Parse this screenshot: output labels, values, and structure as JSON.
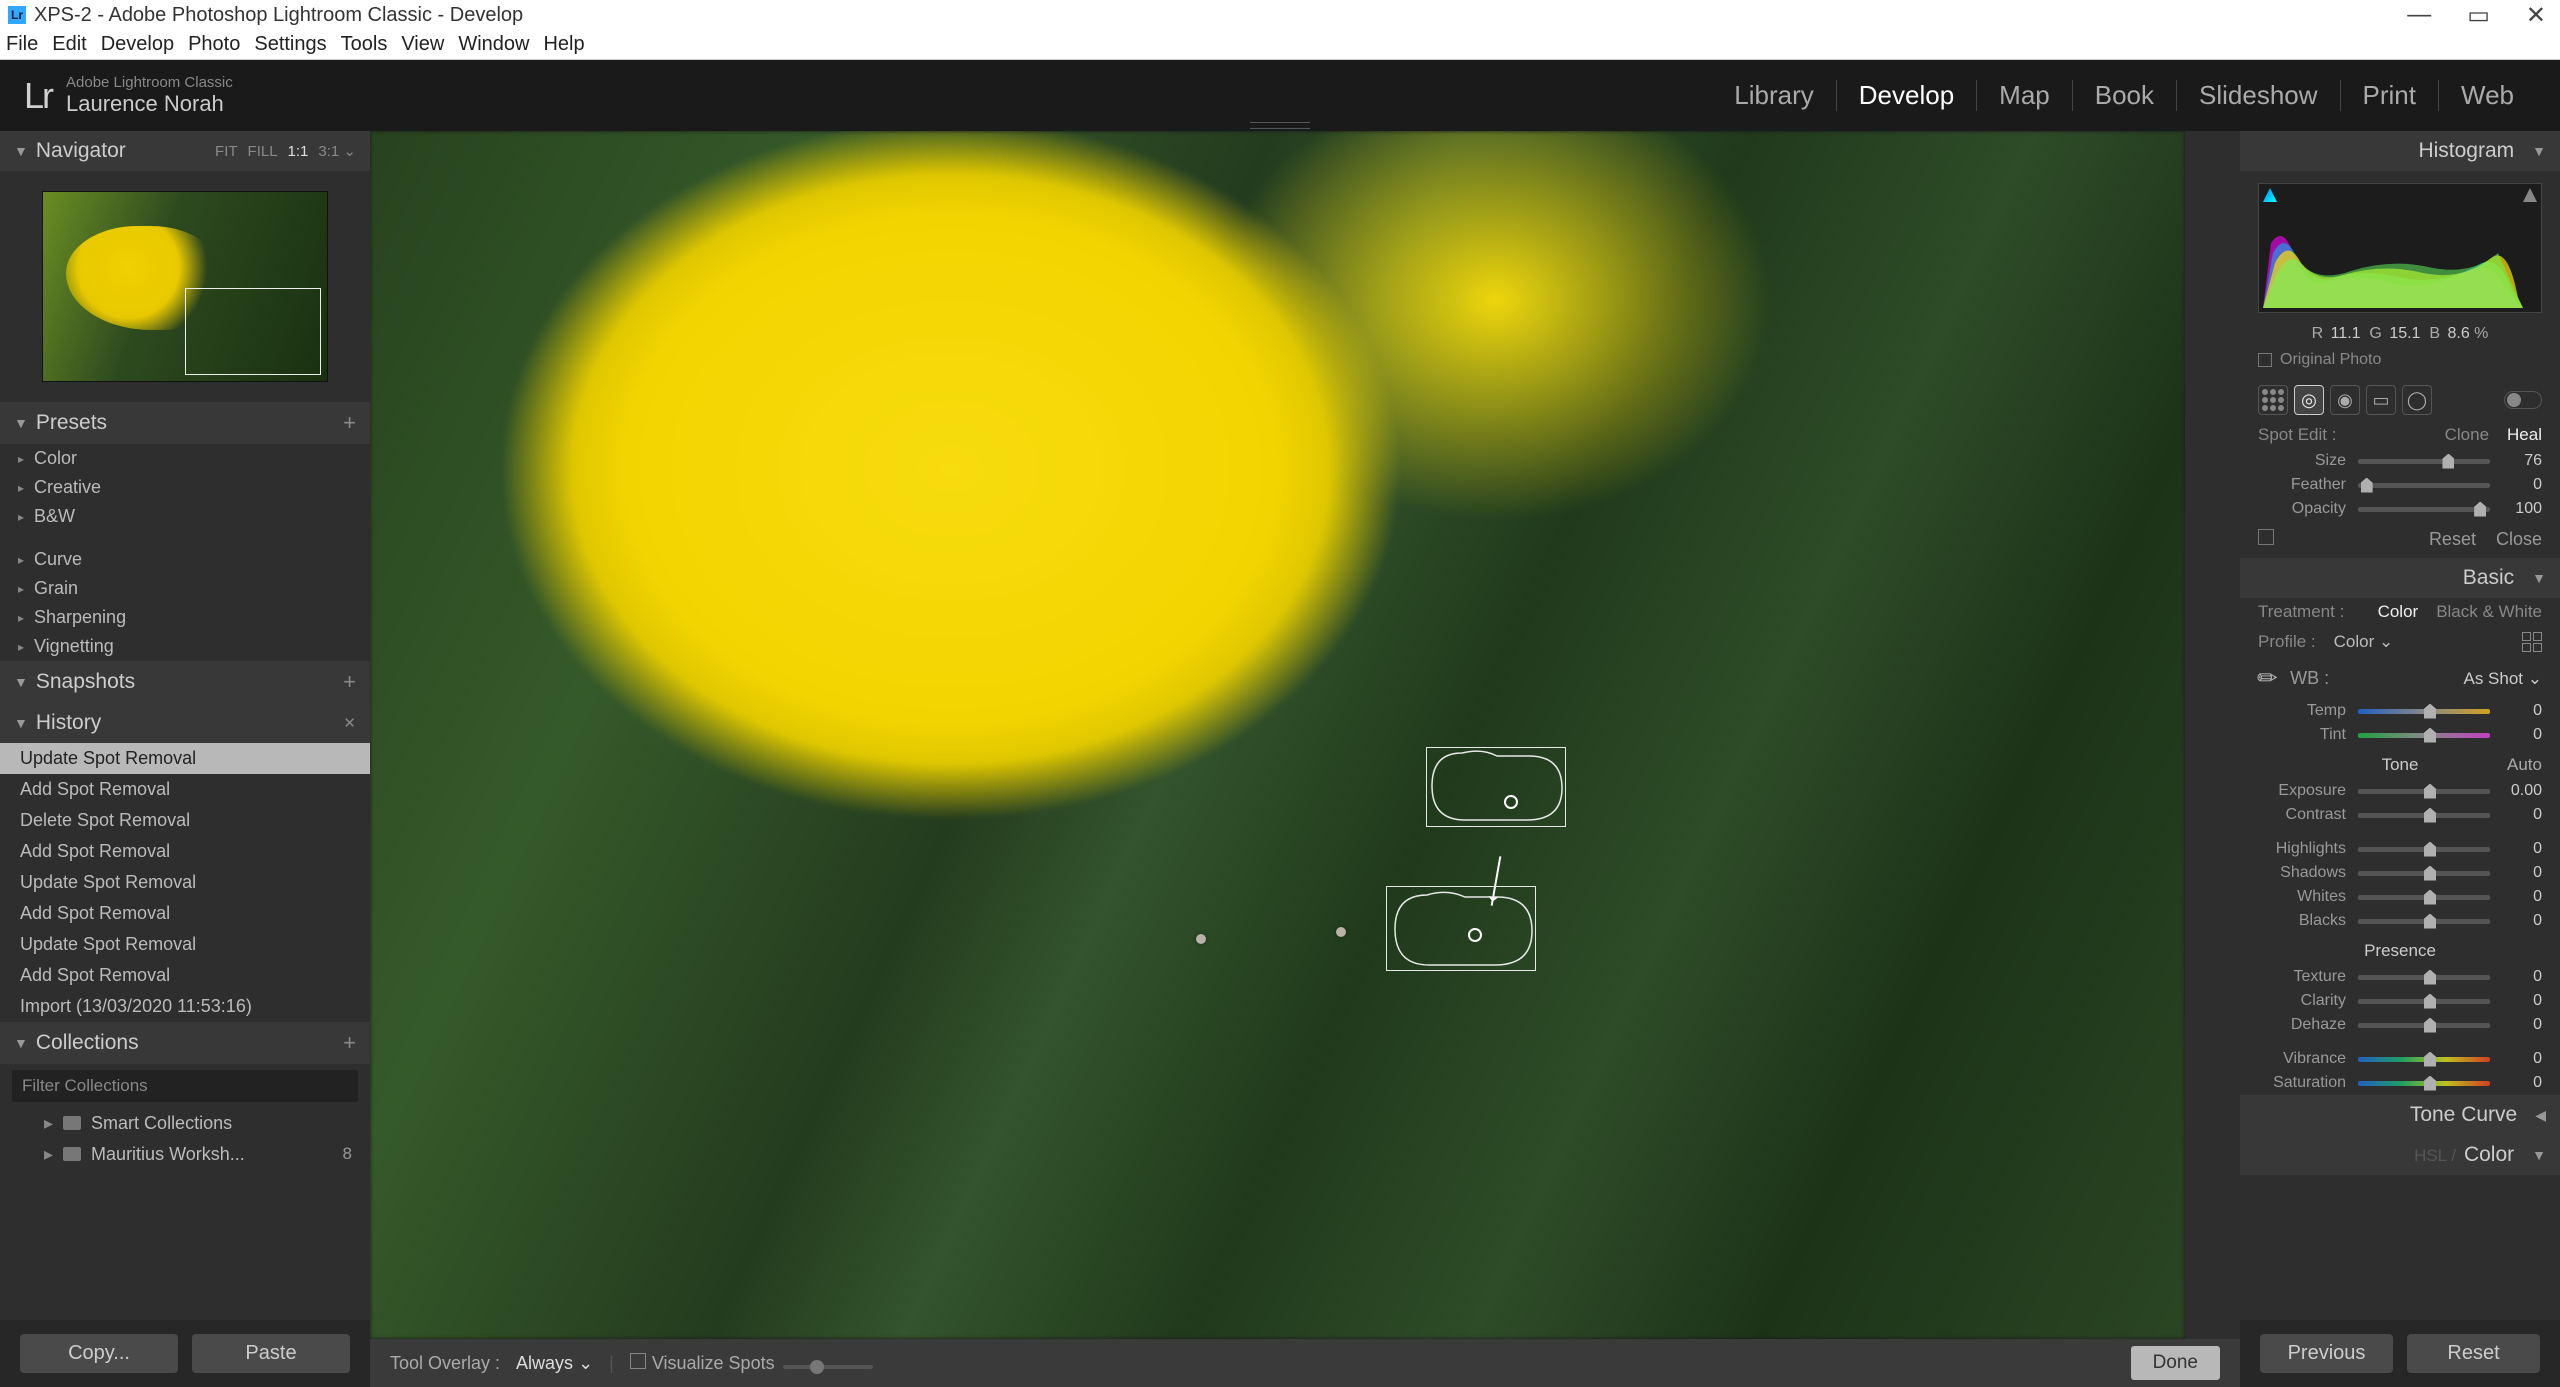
{
  "window": {
    "title": "XPS-2 - Adobe Photoshop Lightroom Classic - Develop",
    "controls": {
      "min": "—",
      "max": "▭",
      "close": "✕"
    }
  },
  "menu": [
    "File",
    "Edit",
    "Develop",
    "Photo",
    "Settings",
    "Tools",
    "View",
    "Window",
    "Help"
  ],
  "brand": {
    "logo": "Lr",
    "product": "Adobe Lightroom Classic",
    "user": "Laurence Norah"
  },
  "modules": [
    {
      "label": "Library",
      "active": false
    },
    {
      "label": "Develop",
      "active": true
    },
    {
      "label": "Map",
      "active": false
    },
    {
      "label": "Book",
      "active": false
    },
    {
      "label": "Slideshow",
      "active": false
    },
    {
      "label": "Print",
      "active": false
    },
    {
      "label": "Web",
      "active": false
    }
  ],
  "left": {
    "navigator": {
      "title": "Navigator",
      "zoom_opts": [
        "FIT",
        "FILL",
        "1:1",
        "3:1 ⌄"
      ]
    },
    "presets": {
      "title": "Presets",
      "items": [
        "Color",
        "Creative",
        "B&W",
        "",
        "Curve",
        "Grain",
        "Sharpening",
        "Vignetting"
      ]
    },
    "snapshots": {
      "title": "Snapshots"
    },
    "history": {
      "title": "History",
      "items": [
        {
          "label": "Update Spot Removal",
          "sel": true
        },
        {
          "label": "Add Spot Removal"
        },
        {
          "label": "Delete Spot Removal"
        },
        {
          "label": "Add Spot Removal"
        },
        {
          "label": "Update Spot Removal"
        },
        {
          "label": "Add Spot Removal"
        },
        {
          "label": "Update Spot Removal"
        },
        {
          "label": "Add Spot Removal"
        },
        {
          "label": "Import (13/03/2020 11:53:16)"
        }
      ]
    },
    "collections": {
      "title": "Collections",
      "filter_placeholder": "Filter Collections",
      "items": [
        {
          "label": "Smart Collections",
          "count": ""
        },
        {
          "label": "Mauritius Worksh...",
          "count": "8"
        }
      ]
    },
    "buttons": {
      "copy": "Copy...",
      "paste": "Paste"
    }
  },
  "center": {
    "toolstrip": {
      "overlay_label": "Tool Overlay :",
      "overlay_value": "Always ⌄",
      "visualize": "Visualize Spots",
      "done": "Done"
    }
  },
  "right": {
    "histogram": {
      "title": "Histogram",
      "rgb": {
        "r": "11.1",
        "g": "15.1",
        "b": "8.6",
        "pct": "%"
      },
      "original": "Original Photo"
    },
    "spot": {
      "label": "Spot Edit :",
      "modes": {
        "clone": "Clone",
        "heal": "Heal",
        "active": "heal"
      },
      "sliders": [
        {
          "name": "Size",
          "value": "76",
          "pos": 64
        },
        {
          "name": "Feather",
          "value": "0",
          "pos": 2
        },
        {
          "name": "Opacity",
          "value": "100",
          "pos": 88
        }
      ],
      "reset": "Reset",
      "close": "Close"
    },
    "basic": {
      "title": "Basic",
      "treatment": {
        "label": "Treatment :",
        "color": "Color",
        "bw": "Black & White",
        "active": "color"
      },
      "profile": {
        "label": "Profile :",
        "value": "Color ⌄"
      },
      "wb": {
        "label": "WB :",
        "value": "As Shot ⌄"
      },
      "wb_sliders": [
        {
          "name": "Temp",
          "value": "0",
          "pos": 50,
          "grad": "temp"
        },
        {
          "name": "Tint",
          "value": "0",
          "pos": 50,
          "grad": "tint"
        }
      ],
      "tone_label": "Tone",
      "auto": "Auto",
      "tone": [
        {
          "name": "Exposure",
          "value": "0.00",
          "pos": 50
        },
        {
          "name": "Contrast",
          "value": "0",
          "pos": 50
        }
      ],
      "tone2": [
        {
          "name": "Highlights",
          "value": "0",
          "pos": 50
        },
        {
          "name": "Shadows",
          "value": "0",
          "pos": 50
        },
        {
          "name": "Whites",
          "value": "0",
          "pos": 50
        },
        {
          "name": "Blacks",
          "value": "0",
          "pos": 50
        }
      ],
      "presence_label": "Presence",
      "presence": [
        {
          "name": "Texture",
          "value": "0",
          "pos": 50
        },
        {
          "name": "Clarity",
          "value": "0",
          "pos": 50
        },
        {
          "name": "Dehaze",
          "value": "0",
          "pos": 50
        }
      ],
      "color": [
        {
          "name": "Vibrance",
          "value": "0",
          "pos": 50,
          "grad": "vib"
        },
        {
          "name": "Saturation",
          "value": "0",
          "pos": 50,
          "grad": "vib"
        }
      ]
    },
    "collapsed": [
      {
        "title": "Tone Curve",
        "tri": "◀"
      },
      {
        "title": "HSL / Color",
        "sub": "HSL /",
        "main": "Color",
        "tri": "▼"
      }
    ],
    "buttons": {
      "previous": "Previous",
      "reset": "Reset"
    }
  }
}
